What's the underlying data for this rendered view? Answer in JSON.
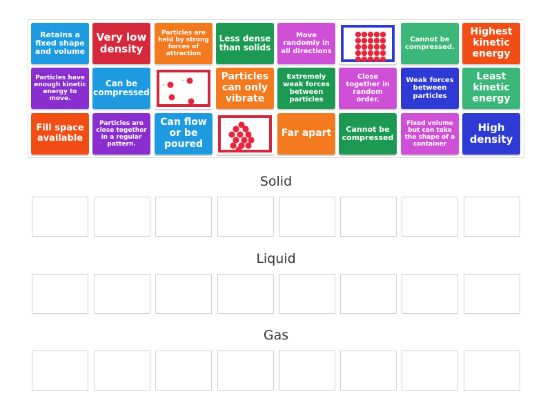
{
  "tray": {
    "cards": [
      {
        "text": "Retains a fixed shape and volume",
        "color": "#1e9be0",
        "fs": 11
      },
      {
        "text": "Very low density",
        "color": "#d5283b",
        "fs": 15
      },
      {
        "text": "Particles are held by strong forces of attraction",
        "color": "#f47a1f",
        "fs": 9
      },
      {
        "text": "Less dense than solids",
        "color": "#1c9a54",
        "fs": 12
      },
      {
        "text": "Move randomly in all directions",
        "color": "#cf4fd6",
        "fs": 10
      },
      {
        "image": "solid-particles-icon",
        "color": "#2d3bd4"
      },
      {
        "text": "Cannot be compressed.",
        "color": "#3bb879",
        "fs": 10
      },
      {
        "text": "Highest kinetic energy",
        "color": "#f14d15",
        "fs": 14
      },
      {
        "text": "Particles have enough kinetic energy to move.",
        "color": "#8a2ed0",
        "fs": 9
      },
      {
        "text": "Can be compressed",
        "color": "#1e9be0",
        "fs": 12
      },
      {
        "image": "gas-particles-icon",
        "color": "#d3283b"
      },
      {
        "text": "Particles can only vibrate",
        "color": "#f47a1f",
        "fs": 14
      },
      {
        "text": "Extremely weak forces between particles",
        "color": "#1c9a54",
        "fs": 10
      },
      {
        "text": "Close together in random order.",
        "color": "#cf4fd6",
        "fs": 10
      },
      {
        "text": "Weak forces between particles",
        "color": "#2d3bd4",
        "fs": 10
      },
      {
        "text": "Least kinetic energy",
        "color": "#3bb879",
        "fs": 14
      },
      {
        "text": "Fill space available",
        "color": "#f14d15",
        "fs": 13
      },
      {
        "text": "Particles are close together in a regular pattern.",
        "color": "#8a2ed0",
        "fs": 9
      },
      {
        "text": "Can flow or be poured",
        "color": "#1e9be0",
        "fs": 14
      },
      {
        "image": "liquid-particles-icon",
        "color": "#d3283b"
      },
      {
        "text": "Far apart",
        "color": "#f47a1f",
        "fs": 14
      },
      {
        "text": "Cannot be compressed",
        "color": "#1c9a54",
        "fs": 11
      },
      {
        "text": "Fixed volume but can take the shape of a container",
        "color": "#cf4fd6",
        "fs": 9
      },
      {
        "text": "High density",
        "color": "#2d3bd4",
        "fs": 15
      }
    ]
  },
  "groups": [
    {
      "title": "Solid",
      "slots": 8
    },
    {
      "title": "Liquid",
      "slots": 8
    },
    {
      "title": "Gas",
      "slots": 8
    }
  ]
}
